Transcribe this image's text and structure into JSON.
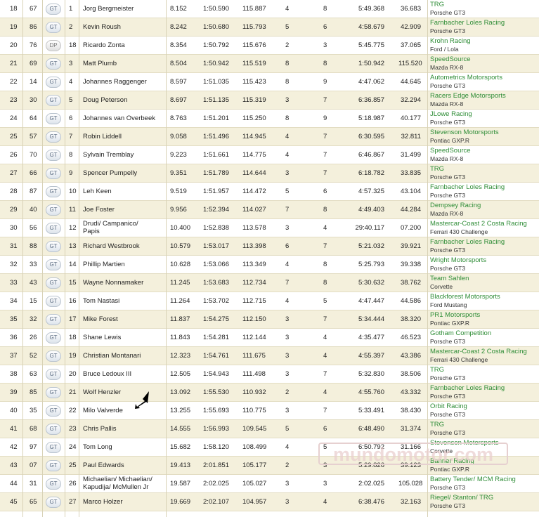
{
  "results": [
    {
      "pos": "18",
      "num": "67",
      "cls": "GT",
      "cpos": "1",
      "driver": [
        "Jorg Bergmeister"
      ],
      "gap": "8.152",
      "best": "1:50.590",
      "speed": "115.887",
      "lap": "4",
      "tot": "8",
      "time": "5:49.368",
      "diff": "36.683",
      "team": "TRG",
      "car": "Porsche GT3"
    },
    {
      "pos": "19",
      "num": "86",
      "cls": "GT",
      "cpos": "2",
      "driver": [
        "Kevin Roush"
      ],
      "gap": "8.242",
      "best": "1:50.680",
      "speed": "115.793",
      "lap": "5",
      "tot": "6",
      "time": "4:58.679",
      "diff": "42.909",
      "team": "Farnbacher Loles Racing",
      "car": "Porsche GT3"
    },
    {
      "pos": "20",
      "num": "76",
      "cls": "DP",
      "cpos": "18",
      "driver": [
        "Ricardo Zonta"
      ],
      "gap": "8.354",
      "best": "1:50.792",
      "speed": "115.676",
      "lap": "2",
      "tot": "3",
      "time": "5:45.775",
      "diff": "37.065",
      "team": "Krohn Racing",
      "car": "Ford / Lola"
    },
    {
      "pos": "21",
      "num": "69",
      "cls": "GT",
      "cpos": "3",
      "driver": [
        "Matt Plumb"
      ],
      "gap": "8.504",
      "best": "1:50.942",
      "speed": "115.519",
      "lap": "8",
      "tot": "8",
      "time": "1:50.942",
      "diff": "115.520",
      "team": "SpeedSource",
      "car": "Mazda RX-8"
    },
    {
      "pos": "22",
      "num": "14",
      "cls": "GT",
      "cpos": "4",
      "driver": [
        "Johannes Raggenger"
      ],
      "gap": "8.597",
      "best": "1:51.035",
      "speed": "115.423",
      "lap": "8",
      "tot": "9",
      "time": "4:47.062",
      "diff": "44.645",
      "team": "Autometrics Motorsports",
      "car": "Porsche GT3"
    },
    {
      "pos": "23",
      "num": "30",
      "cls": "GT",
      "cpos": "5",
      "driver": [
        "Doug Peterson"
      ],
      "gap": "8.697",
      "best": "1:51.135",
      "speed": "115.319",
      "lap": "3",
      "tot": "7",
      "time": "6:36.857",
      "diff": "32.294",
      "team": "Racers Edge Motorsports",
      "car": "Mazda RX-8"
    },
    {
      "pos": "24",
      "num": "64",
      "cls": "GT",
      "cpos": "6",
      "driver": [
        "Johannes van Overbeek"
      ],
      "gap": "8.763",
      "best": "1:51.201",
      "speed": "115.250",
      "lap": "8",
      "tot": "9",
      "time": "5:18.987",
      "diff": "40.177",
      "team": "JLowe Racing",
      "car": "Porsche GT3"
    },
    {
      "pos": "25",
      "num": "57",
      "cls": "GT",
      "cpos": "7",
      "driver": [
        "Robin Liddell"
      ],
      "gap": "9.058",
      "best": "1:51.496",
      "speed": "114.945",
      "lap": "4",
      "tot": "7",
      "time": "6:30.595",
      "diff": "32.811",
      "team": "Stevenson Motorsports",
      "car": "Pontiac GXP.R"
    },
    {
      "pos": "26",
      "num": "70",
      "cls": "GT",
      "cpos": "8",
      "driver": [
        "Sylvain Tremblay"
      ],
      "gap": "9.223",
      "best": "1:51.661",
      "speed": "114.775",
      "lap": "4",
      "tot": "7",
      "time": "6:46.867",
      "diff": "31.499",
      "team": "SpeedSource",
      "car": "Mazda RX-8"
    },
    {
      "pos": "27",
      "num": "66",
      "cls": "GT",
      "cpos": "9",
      "driver": [
        "Spencer Pumpelly"
      ],
      "gap": "9.351",
      "best": "1:51.789",
      "speed": "114.644",
      "lap": "3",
      "tot": "7",
      "time": "6:18.782",
      "diff": "33.835",
      "team": "TRG",
      "car": "Porsche GT3"
    },
    {
      "pos": "28",
      "num": "87",
      "cls": "GT",
      "cpos": "10",
      "driver": [
        "Leh Keen"
      ],
      "gap": "9.519",
      "best": "1:51.957",
      "speed": "114.472",
      "lap": "5",
      "tot": "6",
      "time": "4:57.325",
      "diff": "43.104",
      "team": "Farnbacher Loles Racing",
      "car": "Porsche GT3"
    },
    {
      "pos": "29",
      "num": "40",
      "cls": "GT",
      "cpos": "11",
      "driver": [
        "Joe Foster"
      ],
      "gap": "9.956",
      "best": "1:52.394",
      "speed": "114.027",
      "lap": "7",
      "tot": "8",
      "time": "4:49.403",
      "diff": "44.284",
      "team": "Dempsey Racing",
      "car": "Mazda RX-8"
    },
    {
      "pos": "30",
      "num": "56",
      "cls": "GT",
      "cpos": "12",
      "driver": [
        "Drudi/ Campanico/",
        "Papis"
      ],
      "gap": "10.400",
      "best": "1:52.838",
      "speed": "113.578",
      "lap": "3",
      "tot": "4",
      "time": "29:40.117",
      "diff": "07.200",
      "team": "Mastercar-Coast 2 Costa Racing",
      "car": "Ferrari 430 Challenge"
    },
    {
      "pos": "31",
      "num": "88",
      "cls": "GT",
      "cpos": "13",
      "driver": [
        "Richard Westbrook"
      ],
      "gap": "10.579",
      "best": "1:53.017",
      "speed": "113.398",
      "lap": "6",
      "tot": "7",
      "time": "5:21.032",
      "diff": "39.921",
      "team": "Farnbacher Loles Racing",
      "car": "Porsche GT3"
    },
    {
      "pos": "32",
      "num": "33",
      "cls": "GT",
      "cpos": "14",
      "driver": [
        "Phillip Martien"
      ],
      "gap": "10.628",
      "best": "1:53.066",
      "speed": "113.349",
      "lap": "4",
      "tot": "8",
      "time": "5:25.793",
      "diff": "39.338",
      "team": "Wright Motorsports",
      "car": "Porsche GT3"
    },
    {
      "pos": "33",
      "num": "43",
      "cls": "GT",
      "cpos": "15",
      "driver": [
        "Wayne Nonnamaker"
      ],
      "gap": "11.245",
      "best": "1:53.683",
      "speed": "112.734",
      "lap": "7",
      "tot": "8",
      "time": "5:30.632",
      "diff": "38.762",
      "team": "Team Sahlen",
      "car": "Corvette"
    },
    {
      "pos": "34",
      "num": "15",
      "cls": "GT",
      "cpos": "16",
      "driver": [
        "Tom Nastasi"
      ],
      "gap": "11.264",
      "best": "1:53.702",
      "speed": "112.715",
      "lap": "4",
      "tot": "5",
      "time": "4:47.447",
      "diff": "44.586",
      "team": "Blackforest Motorsports",
      "car": "Ford Mustang"
    },
    {
      "pos": "35",
      "num": "32",
      "cls": "GT",
      "cpos": "17",
      "driver": [
        "Mike Forest"
      ],
      "gap": "11.837",
      "best": "1:54.275",
      "speed": "112.150",
      "lap": "3",
      "tot": "7",
      "time": "5:34.444",
      "diff": "38.320",
      "team": "PR1 Motorsports",
      "car": "Pontiac GXP.R"
    },
    {
      "pos": "36",
      "num": "26",
      "cls": "GT",
      "cpos": "18",
      "driver": [
        "Shane Lewis"
      ],
      "gap": "11.843",
      "best": "1:54.281",
      "speed": "112.144",
      "lap": "3",
      "tot": "4",
      "time": "4:35.477",
      "diff": "46.523",
      "team": "Gotham Competition",
      "car": "Porsche GT3"
    },
    {
      "pos": "37",
      "num": "52",
      "cls": "GT",
      "cpos": "19",
      "driver": [
        "Christian Montanari"
      ],
      "gap": "12.323",
      "best": "1:54.761",
      "speed": "111.675",
      "lap": "3",
      "tot": "4",
      "time": "4:55.397",
      "diff": "43.386",
      "team": "Mastercar-Coast 2 Costa Racing",
      "car": "Ferrari 430 Challenge"
    },
    {
      "pos": "38",
      "num": "63",
      "cls": "GT",
      "cpos": "20",
      "driver": [
        "Bruce Ledoux III"
      ],
      "gap": "12.505",
      "best": "1:54.943",
      "speed": "111.498",
      "lap": "3",
      "tot": "7",
      "time": "5:32.830",
      "diff": "38.506",
      "team": "TRG",
      "car": "Porsche GT3"
    },
    {
      "pos": "39",
      "num": "85",
      "cls": "GT",
      "cpos": "21",
      "driver": [
        "Wolf Henzler"
      ],
      "gap": "13.092",
      "best": "1:55.530",
      "speed": "110.932",
      "lap": "2",
      "tot": "4",
      "time": "4:55.760",
      "diff": "43.332",
      "team": "Farnbacher Loles Racing",
      "car": "Porsche GT3"
    },
    {
      "pos": "40",
      "num": "35",
      "cls": "GT",
      "cpos": "22",
      "driver": [
        "Milo Valverde"
      ],
      "gap": "13.255",
      "best": "1:55.693",
      "speed": "110.775",
      "lap": "3",
      "tot": "7",
      "time": "5:33.491",
      "diff": "38.430",
      "team": "Orbit Racing",
      "car": "Porsche GT3"
    },
    {
      "pos": "41",
      "num": "68",
      "cls": "GT",
      "cpos": "23",
      "driver": [
        "Chris Pallis"
      ],
      "gap": "14.555",
      "best": "1:56.993",
      "speed": "109.545",
      "lap": "5",
      "tot": "6",
      "time": "6:48.490",
      "diff": "31.374",
      "team": "TRG",
      "car": "Porsche GT3"
    },
    {
      "pos": "42",
      "num": "97",
      "cls": "GT",
      "cpos": "24",
      "driver": [
        "Tom Long"
      ],
      "gap": "15.682",
      "best": "1:58.120",
      "speed": "108.499",
      "lap": "4",
      "tot": "5",
      "time": "6:50.792",
      "diff": "31.166",
      "team": "Stevenson Motorsports",
      "car": "Corvette"
    },
    {
      "pos": "43",
      "num": "07",
      "cls": "GT",
      "cpos": "25",
      "driver": [
        "Paul Edwards"
      ],
      "gap": "19.413",
      "best": "2:01.851",
      "speed": "105.177",
      "lap": "2",
      "tot": "3",
      "time": "5:29.826",
      "diff": "39.123",
      "team": "Banner Racing",
      "car": "Pontiac GXP.R"
    },
    {
      "pos": "44",
      "num": "31",
      "cls": "GT",
      "cpos": "26",
      "driver": [
        "Michaelian/ Michaelian/",
        "Kapudija/ McMullen Jr"
      ],
      "gap": "19.587",
      "best": "2:02.025",
      "speed": "105.027",
      "lap": "3",
      "tot": "3",
      "time": "2:02.025",
      "diff": "105.028",
      "team": "Battery Tender/ MCM Racing",
      "car": "Porsche GT3"
    },
    {
      "pos": "45",
      "num": "65",
      "cls": "GT",
      "cpos": "27",
      "driver": [
        "Marco Holzer"
      ],
      "gap": "19.669",
      "best": "2:02.107",
      "speed": "104.957",
      "lap": "3",
      "tot": "4",
      "time": "6:38.476",
      "diff": "32.163",
      "team": "Riegel/ Stanton/ TRG",
      "car": "Porsche GT3"
    }
  ],
  "watermark": "mundomotor.com",
  "colors": {
    "row_alt": "#f4f0dc",
    "team_link": "#2f8d37",
    "separator": "#e3ddc3"
  }
}
